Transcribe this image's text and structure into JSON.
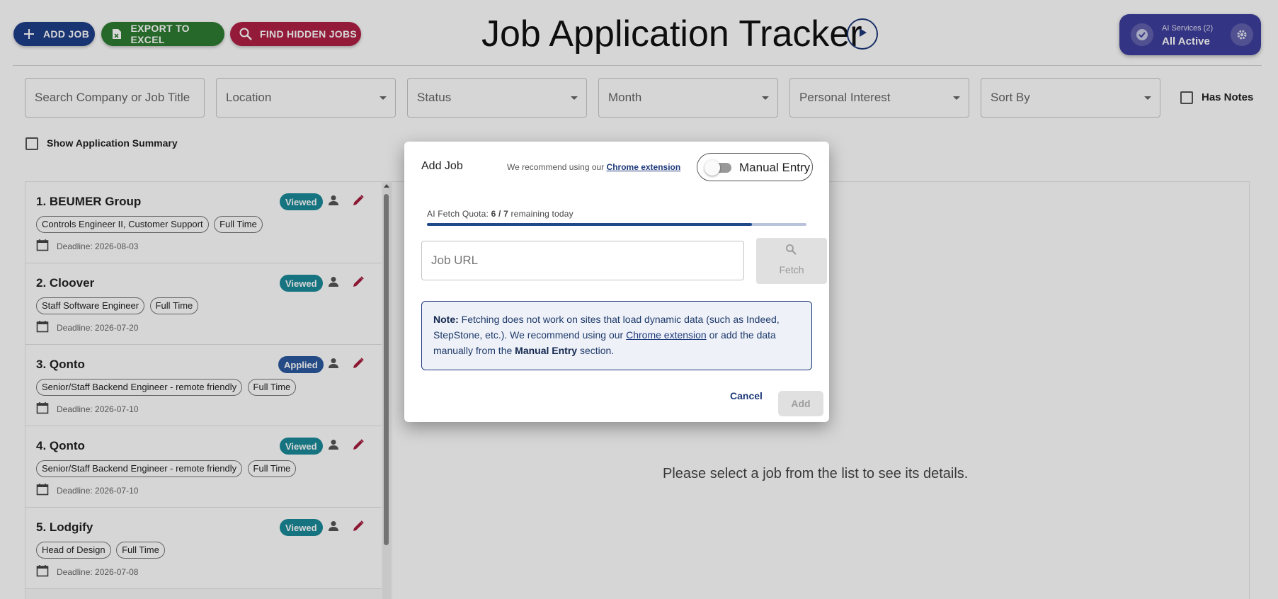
{
  "header": {
    "add_job": "ADD JOB",
    "export": "EXPORT TO EXCEL",
    "find_hidden": "FIND HIDDEN JOBS",
    "title": "Job Application Tracker",
    "ai_label": "AI Services (2)",
    "ai_status": "All Active"
  },
  "filters": {
    "search_placeholder": "Search Company or Job Title",
    "location": "Location",
    "status": "Status",
    "month": "Month",
    "personal_interest": "Personal Interest",
    "sort_by": "Sort By",
    "has_notes": "Has Notes",
    "show_summary": "Show Application Summary"
  },
  "jobs": [
    {
      "title": "1. BEUMER Group",
      "status": "Viewed",
      "role": "Controls Engineer II, Customer Support",
      "type": "Full Time",
      "deadline": "Deadline: 2026-08-03"
    },
    {
      "title": "2. Cloover",
      "status": "Viewed",
      "role": "Staff Software Engineer",
      "type": "Full Time",
      "deadline": "Deadline: 2026-07-20"
    },
    {
      "title": "3. Qonto",
      "status": "Applied",
      "role": "Senior/Staff Backend Engineer - remote friendly",
      "type": "Full Time",
      "deadline": "Deadline: 2026-07-10"
    },
    {
      "title": "4. Qonto",
      "status": "Viewed",
      "role": "Senior/Staff Backend Engineer - remote friendly",
      "type": "Full Time",
      "deadline": "Deadline: 2026-07-10"
    },
    {
      "title": "5. Lodgify",
      "status": "Viewed",
      "role": "Head of Design",
      "type": "Full Time",
      "deadline": "Deadline: 2026-07-08"
    }
  ],
  "detail": {
    "empty_message": "Please select a job from the list to see its details."
  },
  "dialog": {
    "title": "Add Job",
    "recommend_text": "We recommend using our",
    "chrome_link": "Chrome extension",
    "manual_toggle": "Manual Entry",
    "quota_prefix": "AI Fetch Quota:",
    "quota_used": "6 / 7",
    "quota_suffix": "remaining today",
    "quota_fraction": 0.857,
    "url_placeholder": "Job URL",
    "fetch": "Fetch",
    "note_label": "Note:",
    "note_text1": "Fetching does not work on sites that load dynamic data (such as Indeed, StepStone, etc.). We recommend using our",
    "note_link": "Chrome extension",
    "note_text2": "or add the data manually from the",
    "note_bold": "Manual Entry",
    "note_text3": "section.",
    "cancel": "Cancel",
    "add": "Add"
  },
  "colors": {
    "add_job": "#1e3f8a",
    "export": "#2e7d32",
    "find_hidden": "#b02145",
    "viewed": "#1b8b9a",
    "applied": "#2c5aa0",
    "accent": "#1e3a7a",
    "edit": "#a61b3c"
  }
}
